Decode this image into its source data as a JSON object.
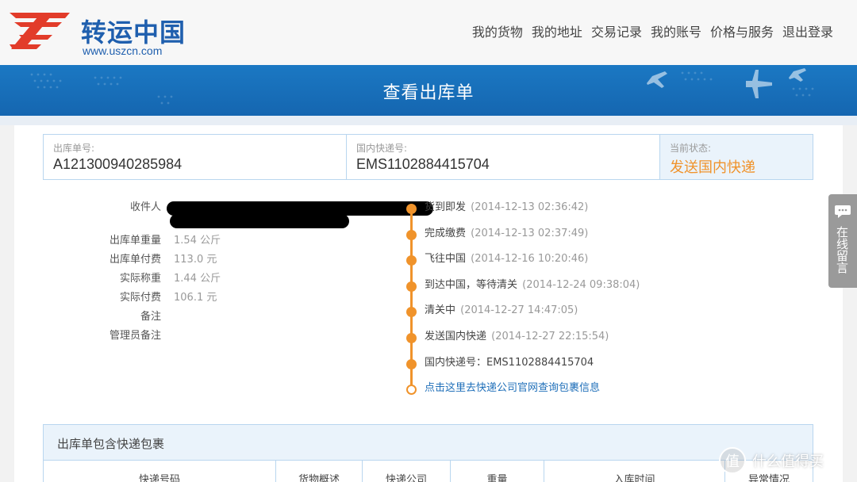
{
  "header": {
    "logo_text": "转运中国",
    "logo_url": "www.uszcn.com",
    "nav": [
      "我的货物",
      "我的地址",
      "交易记录",
      "我的账号",
      "价格与服务",
      "退出登录"
    ]
  },
  "banner": {
    "title": "查看出库单"
  },
  "order": {
    "out_no_label": "出库单号:",
    "out_no": "A121300940285984",
    "express_no_label": "国内快递号:",
    "express_no": "EMS1102884415704",
    "status_label": "当前状态:",
    "status": "发送国内快递"
  },
  "details": [
    {
      "label": "收件人",
      "value": ""
    },
    {
      "label": "出库单重量",
      "value": "1.54 公斤"
    },
    {
      "label": "出库单付费",
      "value": "113.0 元"
    },
    {
      "label": "实际称重",
      "value": "1.44 公斤"
    },
    {
      "label": "实际付费",
      "value": "106.1 元"
    },
    {
      "label": "备注",
      "value": ""
    },
    {
      "label": "管理员备注",
      "value": ""
    }
  ],
  "timeline": [
    {
      "event": "货到即发",
      "time": "(2014-12-13 02:36:42)"
    },
    {
      "event": "完成缴费",
      "time": "(2014-12-13 02:37:49)"
    },
    {
      "event": "飞往中国",
      "time": "(2014-12-16 10:20:46)"
    },
    {
      "event": "到达中国，等待清关",
      "time": "(2014-12-24 09:38:04)"
    },
    {
      "event": "清关中",
      "time": "(2014-12-27 14:47:05)"
    },
    {
      "event": "发送国内快递",
      "time": "(2014-12-27 22:15:54)"
    },
    {
      "event": "国内快递号：EMS1102884415704",
      "time": ""
    }
  ],
  "timeline_link": "点击这里去快递公司官网查询包裹信息",
  "packages": {
    "title": "出库单包含快递包裹",
    "columns": [
      "快递号码",
      "货物概述",
      "快递公司",
      "重量",
      "入库时间",
      "异常情况"
    ]
  },
  "chat": {
    "label": "在线留言"
  },
  "watermark": {
    "symbol": "值",
    "text": "什么值得买"
  },
  "colors": {
    "accent": "#f0932b",
    "brand": "#1f5fae",
    "banner": "#1566b0"
  }
}
